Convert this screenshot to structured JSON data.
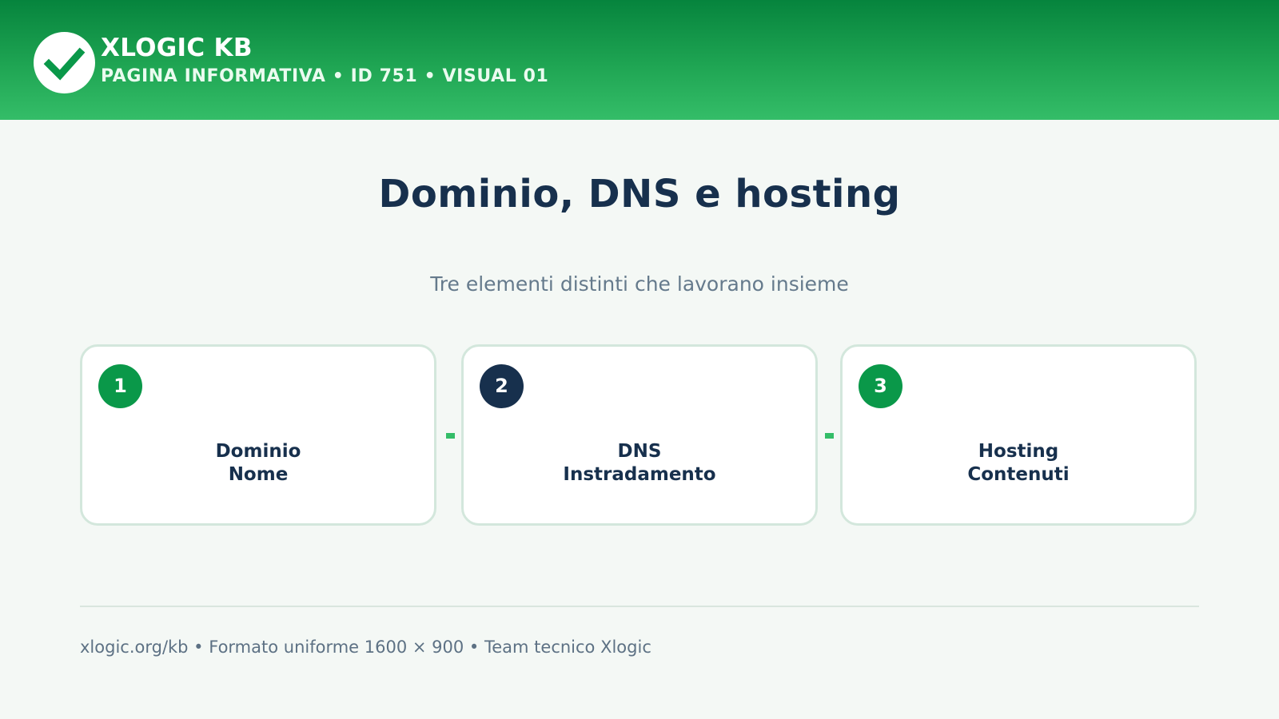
{
  "header": {
    "brand": "XLOGIC KB",
    "subtitle": "PAGINA INFORMATIVA • ID 751 • VISUAL 01",
    "logo_icon": "checkmark-icon"
  },
  "main": {
    "title": "Dominio, DNS e hosting",
    "subtitle": "Tre elementi distinti che lavorano insieme"
  },
  "cards": [
    {
      "number": "1",
      "line1": "Dominio",
      "line2": "Nome",
      "badge_color": "#0a9849"
    },
    {
      "number": "2",
      "line1": "DNS",
      "line2": "Instradamento",
      "badge_color": "#17304d"
    },
    {
      "number": "3",
      "line1": "Hosting",
      "line2": "Contenuti",
      "badge_color": "#0a9849"
    }
  ],
  "footer": {
    "text": "xlogic.org/kb • Formato uniforme 1600 × 900 • Team tecnico Xlogic"
  },
  "colors": {
    "header_top": "#06843d",
    "header_bottom": "#34bd68",
    "title": "#17304d",
    "accent": "#34bd68"
  }
}
